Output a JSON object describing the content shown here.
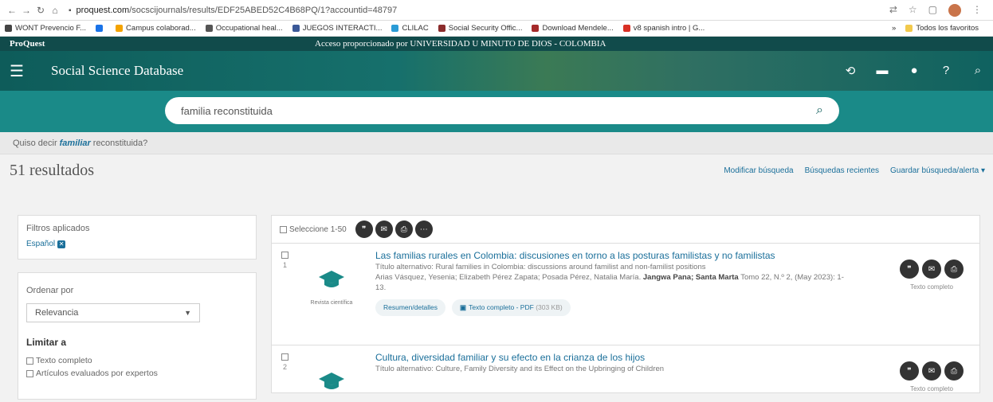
{
  "browser": {
    "url_host": "proquest.com",
    "url_path": "/socscijournals/results/EDF25ABED52C4B68PQ/1?accountid=48797",
    "bookmarks": [
      {
        "label": "WONT Prevencio F...",
        "color": "#444"
      },
      {
        "label": "",
        "color": "#1a73e8"
      },
      {
        "label": "Campus colaborad...",
        "color": "#f4a300"
      },
      {
        "label": "Occupational heal...",
        "color": "#555"
      },
      {
        "label": "JUEGOS INTERACTI...",
        "color": "#3b5998"
      },
      {
        "label": "CLILAC",
        "color": "#2a9bd6"
      },
      {
        "label": "Social Security Offic...",
        "color": "#8b2c2c"
      },
      {
        "label": "Download Mendele...",
        "color": "#a52a2a"
      },
      {
        "label": "v8 spanish intro | G...",
        "color": "#d93025"
      }
    ],
    "bookmarks_more": "»",
    "all_bookmarks": "Todos los favoritos"
  },
  "proquest": {
    "logo": "ProQuest",
    "access": "Acceso proporcionado por UNIVERSIDAD U MINUTO DE DIOS - COLOMBIA",
    "db_title": "Social Science Database"
  },
  "search": {
    "query": "familia reconstituida"
  },
  "suggestion": {
    "prefix": "Quiso decir",
    "word": "familiar",
    "suffix": "reconstituida?"
  },
  "results_header": {
    "count": "51 resultados",
    "links": [
      "Modificar búsqueda",
      "Búsquedas recientes",
      "Guardar búsqueda/alerta ▾"
    ]
  },
  "sidebar": {
    "applied_label": "Filtros aplicados",
    "applied_chip": "Español",
    "sort_label": "Ordenar por",
    "sort_value": "Relevancia",
    "limit_label": "Limitar a",
    "limits": [
      "Texto completo",
      "Artículos evaluados por expertos"
    ]
  },
  "selection": {
    "label": "Seleccione 1-50"
  },
  "results": [
    {
      "num": "1",
      "title": "Las familias rurales en Colombia: discusiones en torno a las posturas familistas y no familistas",
      "alt_title": "Título alternativo: Rural families in Colombia: discussions around familist and non-familist positions",
      "authors": "Arias Vásquez, Yesenia; Elizabeth Pérez Zapata; Posada Pérez, Natalia María.",
      "journal": "Jangwa Pana; Santa Marta",
      "issue": "Tomo 22, N.º 2, (May 2023): 1-13.",
      "type_label": "Revista científica",
      "summary_btn": "Resumen/detalles",
      "pdf_btn": "Texto completo - PDF",
      "pdf_size": "(303 KB)",
      "full_text": "Texto completo"
    },
    {
      "num": "2",
      "title": "Cultura, diversidad familiar y su efecto en la crianza de los hijos",
      "alt_title": "Título alternativo: Culture, Family Diversity and its Effect on the Upbringing of Children",
      "authors": "",
      "journal": "",
      "issue": "",
      "type_label": "",
      "summary_btn": "",
      "pdf_btn": "",
      "pdf_size": "",
      "full_text": "Texto completo"
    }
  ]
}
